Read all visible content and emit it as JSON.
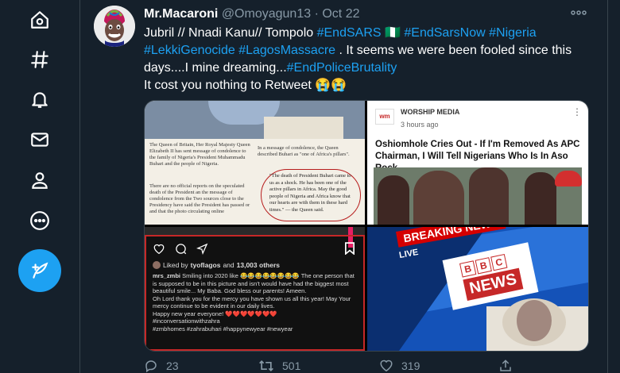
{
  "user": {
    "display_name": "Mr.Macaroni",
    "handle": "@Omoyagun13",
    "separator": "·",
    "date": "Oct 22"
  },
  "tweet": {
    "line1_plain": "Jubril // Nnadi Kanu// Tompolo ",
    "tag_endsars": "#EndSARS",
    "flag": "🇳🇬",
    "tag_endsarsnow": "#EndSarsNow",
    "tag_nigeria": "#Nigeria",
    "tag_lekki": "#LekkiGenocide",
    "tag_lagos": "#LagosMassacre",
    "line2_plain": " . It seems we were been fooled since this days....I mine dreaming...",
    "tag_police": "#EndPoliceBrutality",
    "line3": "It cost you nothing to Retweet 😭😭"
  },
  "media": {
    "q1": {
      "left_text": "The Queen of Britain, Her Royal Majesty Queen Elizabeth II has sent message of condolence to the family of Nigeria's President Muhammadu Buhari and the people of Nigeria.",
      "left_text2": "There are no official reports on the speculated death of the President an the message of condolence from the Two sources close to the Presidency have said the President has passed or and that the photo circulating online",
      "right_text": "In a message of condolence, the Queen described Buhari as \"one of Africa's pillars\".",
      "quote": "\"The death of President Buhari came to us as a shock. He has been one of the active pillars in Africa. May the good people of Nigeria and Africa know that our hearts are with them in these hard times.\" — the Queen said."
    },
    "q2": {
      "source_logo": "wm",
      "source": "WORSHIP MEDIA",
      "time": "3 hours ago",
      "headline": "Oshiomhole Cries Out - If I'm Removed As APC Chairman, I Will Tell Nigerians Who Is In Aso Rock."
    },
    "q3": {
      "liked_by": "Liked by",
      "liked_user": "tyoflagos",
      "liked_and": "and",
      "liked_count": "13,003 others",
      "caption_user": "mrs_zmbi",
      "caption": "Smiling into 2020 like 😂😂😂😂😂😂😂😂 The one person that is supposed to be in this picture and isn't would have had the biggest most beautiful smile... My Baba. God bless our parents! Ameen.",
      "caption2": "Oh Lord thank you for the mercy you have shown us all this year! May Your mercy continue to be evident in our daily lives.",
      "caption3": "Happy new year everyone! ❤️❤️❤️❤️❤️❤️❤️",
      "tags1": "#inconversationwithzahra",
      "tags2": "#zmbhomes #zahrabuhari #happynewyear #newyear"
    },
    "q4": {
      "banner": "BREAKING NEWS",
      "live": "LIVE",
      "bbc_letters": [
        "B",
        "B",
        "C"
      ],
      "news": "NEWS"
    }
  },
  "actions": {
    "reply_count": "23",
    "retweet_count": "501",
    "like_count": "319"
  },
  "colors": {
    "background": "#15202b",
    "accent": "#1da1f2",
    "muted": "#8899a6",
    "border": "#38444d"
  },
  "icons": [
    "home-icon",
    "explore-hash-icon",
    "notifications-bell-icon",
    "messages-envelope-icon",
    "profile-person-icon",
    "more-circle-icon",
    "compose-feather-icon",
    "reply-icon",
    "retweet-icon",
    "like-icon",
    "share-icon"
  ]
}
